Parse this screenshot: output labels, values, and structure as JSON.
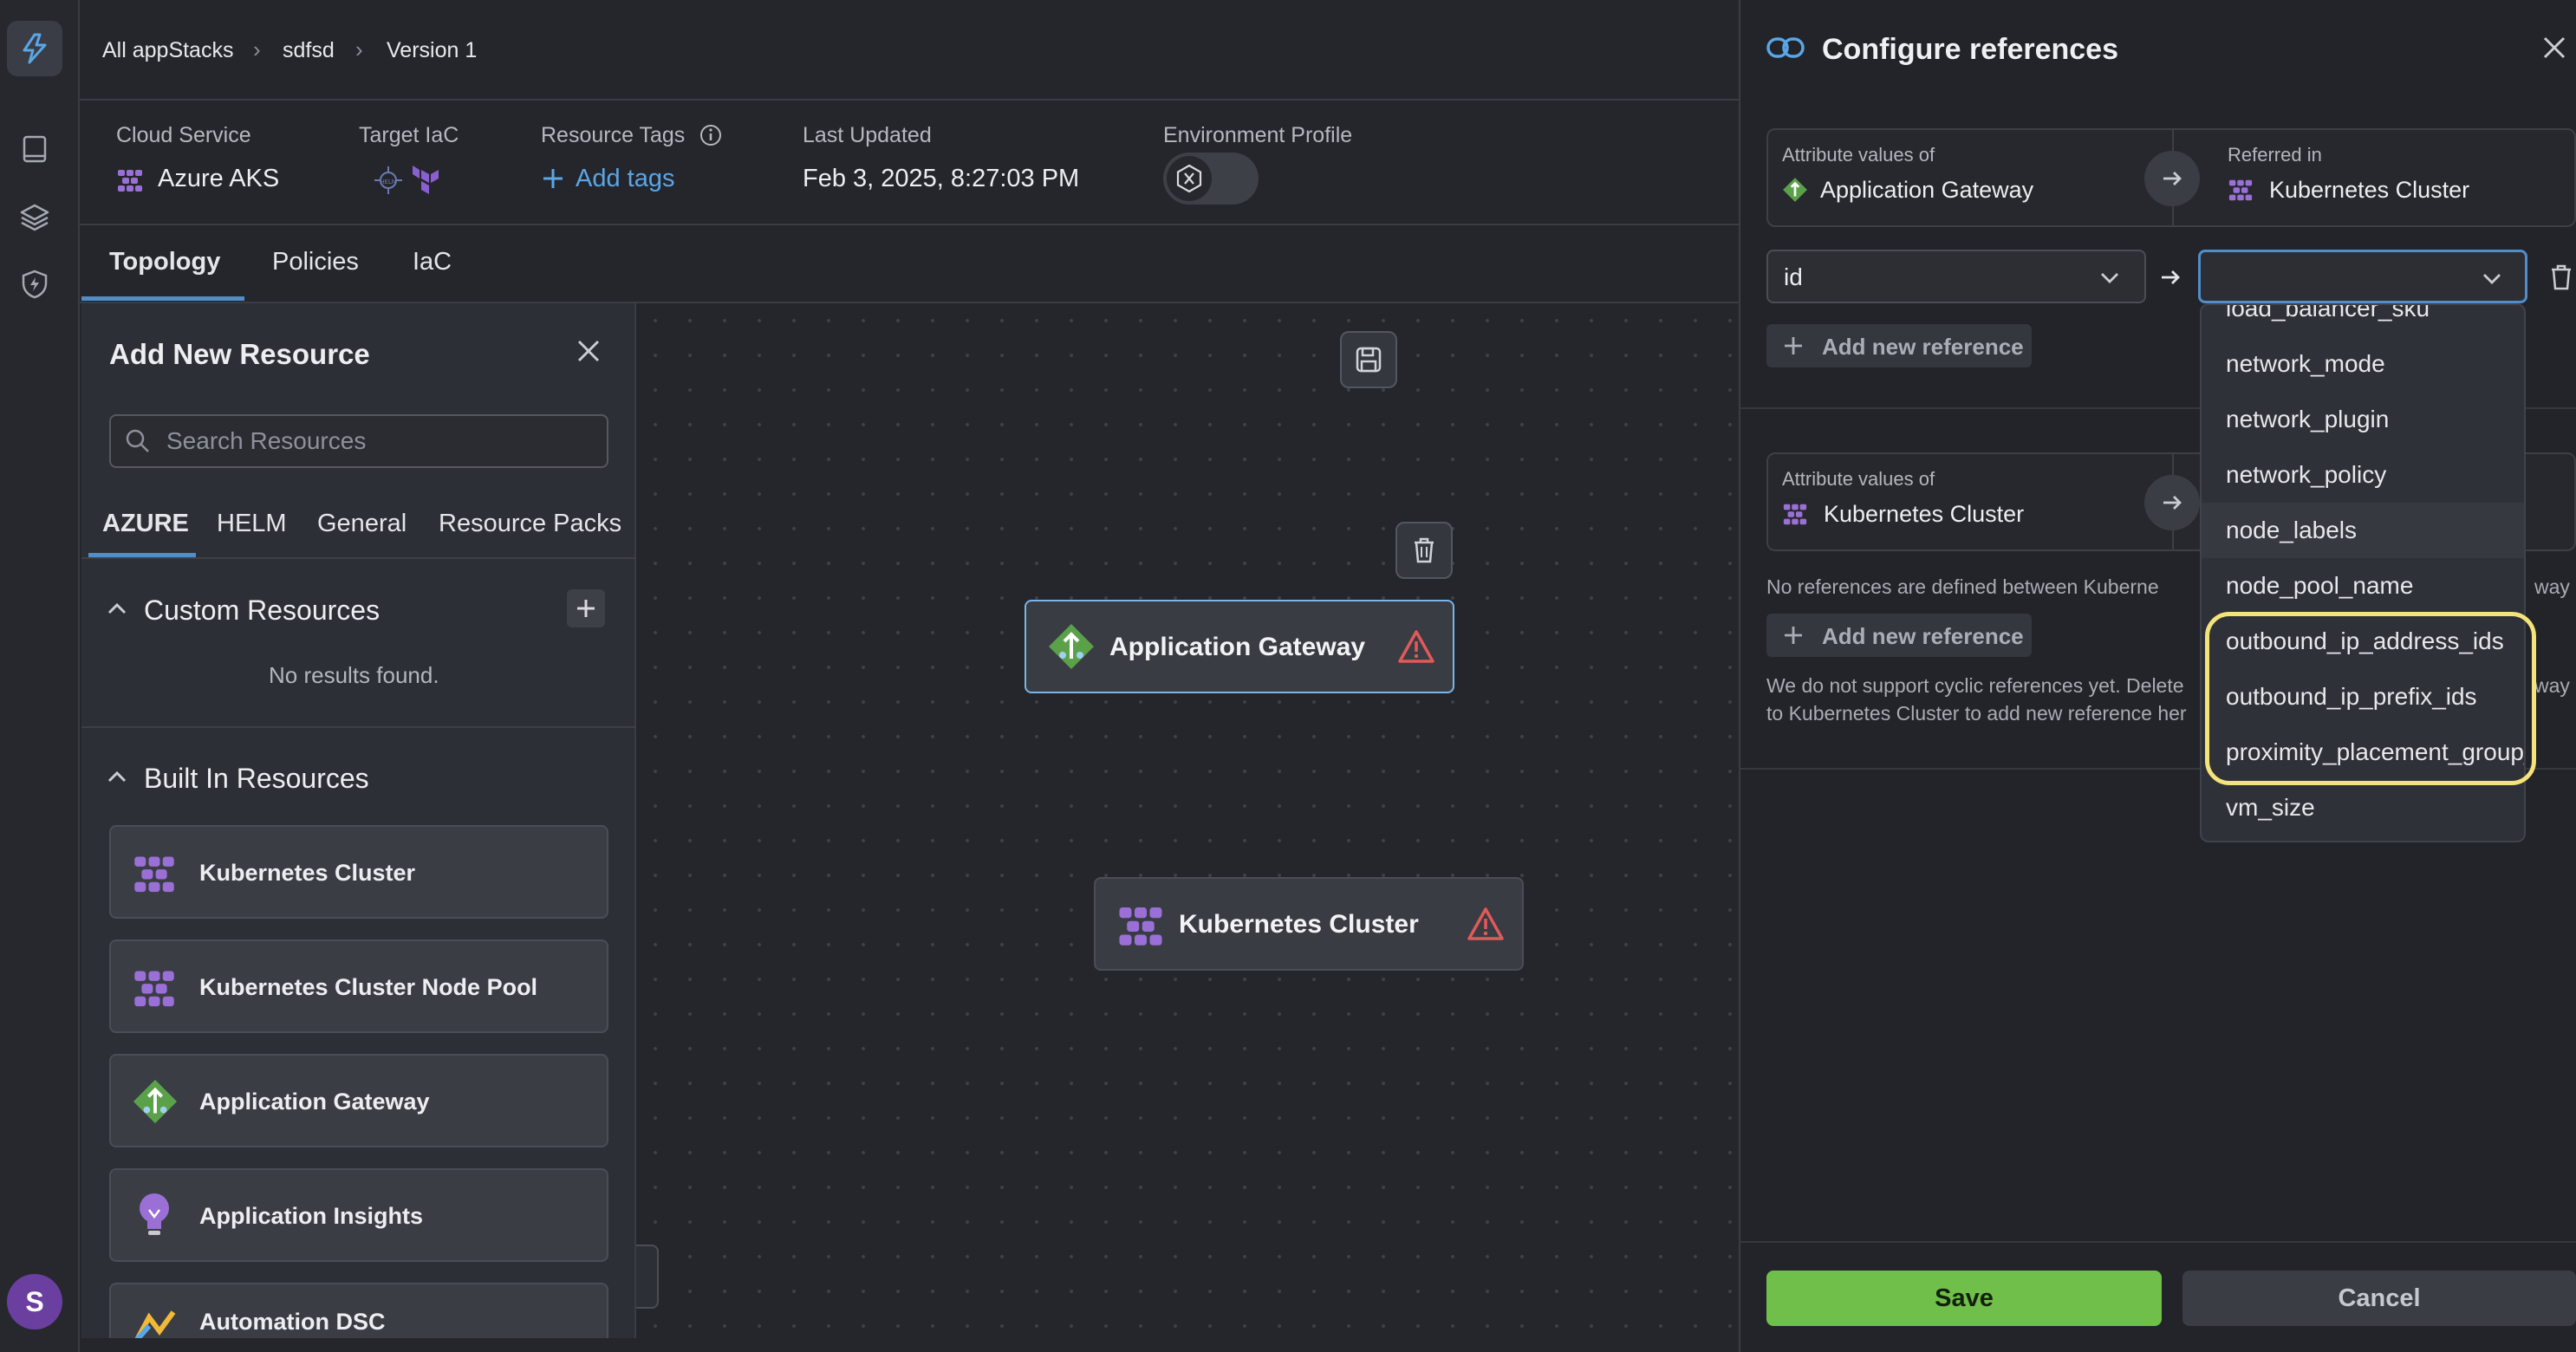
{
  "breadcrumb": {
    "root": "All appStacks",
    "stack": "sdfsd",
    "version": "Version 1"
  },
  "meta": {
    "cloud_service_label": "Cloud Service",
    "cloud_service_value": "Azure AKS",
    "target_iac_label": "Target IaC",
    "resource_tags_label": "Resource Tags",
    "add_tags": "Add tags",
    "last_updated_label": "Last Updated",
    "last_updated_value": "Feb 3, 2025, 8:27:03 PM",
    "env_profile_label": "Environment Profile"
  },
  "tabs": [
    "Topology",
    "Policies",
    "IaC"
  ],
  "add_panel": {
    "title": "Add New Resource",
    "search_placeholder": "Search Resources",
    "resource_tabs": [
      "AZURE",
      "HELM",
      "General",
      "Resource Packs"
    ],
    "custom_resources_title": "Custom Resources",
    "custom_empty": "No results found.",
    "built_in_title": "Built In Resources",
    "built_in_items": [
      "Kubernetes Cluster",
      "Kubernetes Cluster Node Pool",
      "Application Gateway",
      "Application Insights",
      "Automation DSC"
    ]
  },
  "canvas": {
    "node_1": "Application Gateway",
    "node_2": "Kubernetes Cluster"
  },
  "ref_panel": {
    "title": "Configure references",
    "block_1": {
      "attr_label": "Attribute values of",
      "attr_value": "Application Gateway",
      "referred_label": "Referred in",
      "referred_value": "Kubernetes Cluster",
      "source_select": "id",
      "add_reference": "Add new reference"
    },
    "block_2": {
      "attr_label": "Attribute values of",
      "attr_value": "Kubernetes Cluster",
      "no_refs": "No references are defined between Kuberne",
      "no_refs_tail": "way",
      "add_reference": "Add new reference",
      "cyclic_note_1": "We do not support cyclic references yet. Delete",
      "cyclic_note_1_tail": "way",
      "cyclic_note_2": "to Kubernetes Cluster to add new reference her"
    },
    "dropdown_items": [
      "load_balancer_sku",
      "network_mode",
      "network_plugin",
      "network_policy",
      "node_labels",
      "node_pool_name",
      "outbound_ip_address_ids",
      "outbound_ip_prefix_ids",
      "proximity_placement_group_id",
      "vm_size"
    ],
    "save": "Save",
    "cancel": "Cancel"
  },
  "avatar_initial": "S",
  "colors": {
    "accent": "#4f8ec9",
    "save": "#6fbf4a",
    "warning": "#e05a5a",
    "highlight": "#f4e27a"
  }
}
